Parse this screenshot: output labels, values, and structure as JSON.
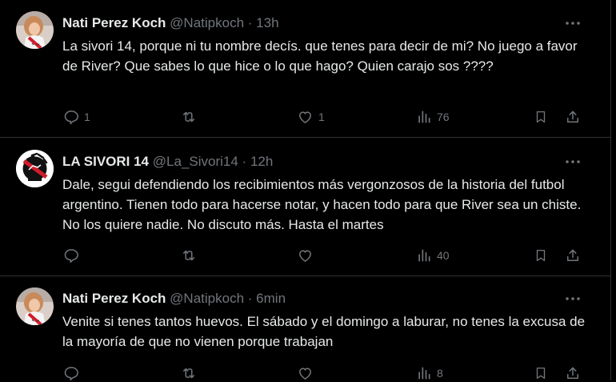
{
  "tweets": [
    {
      "name": "Nati Perez Koch",
      "handle": "@Natipkoch",
      "dot": "·",
      "time": "13h",
      "text": "La sivori 14, porque ni tu nombre decís. que tenes para decir de mi? No juego a favor de River? Que sabes lo que hice o lo que hago? Quien carajo sos ????",
      "replies": "1",
      "retweets": "",
      "likes": "1",
      "views": "76"
    },
    {
      "name": "LA SIVORI 14",
      "handle": "@La_Sivori14",
      "dot": "·",
      "time": "12h",
      "text": "Dale, segui defendiendo los recibimientos más vergonzosos de la historia del futbol argentino. Tienen todo para hacerse notar, y hacen todo para que River sea un chiste. No los quiere nadie. No discuto más. Hasta el martes",
      "replies": "",
      "retweets": "",
      "likes": "",
      "views": "40"
    },
    {
      "name": "Nati Perez Koch",
      "handle": "@Natipkoch",
      "dot": "·",
      "time": "6min",
      "text": "Venite si tenes tantos huevos. El sábado y el domingo a laburar, no tenes la excusa de la mayoría de que no vienen porque trabajan",
      "replies": "",
      "retweets": "",
      "likes": "",
      "views": "8"
    }
  ]
}
